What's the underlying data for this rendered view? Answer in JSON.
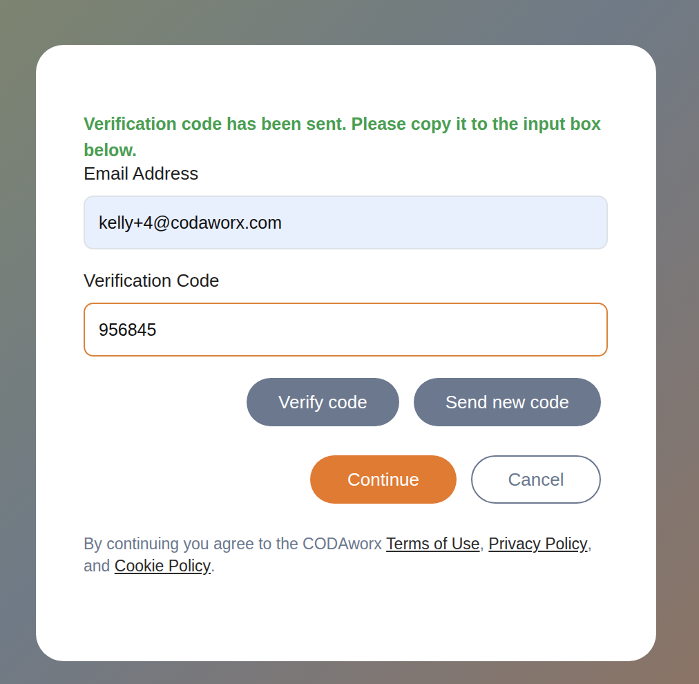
{
  "message": "Verification code has been sent. Please copy it to the input box below.",
  "fields": [
    {
      "label": "Email Address",
      "value": "kelly+4@codaworx.com",
      "kind": "filled",
      "focused": false
    },
    {
      "label": "Verification Code",
      "value": "956845",
      "kind": "plain",
      "focused": true
    }
  ],
  "code_buttons": [
    "Verify code",
    "Send new code"
  ],
  "actions": [
    {
      "label": "Continue",
      "kind": "primary"
    },
    {
      "label": "Cancel",
      "kind": "outline"
    }
  ],
  "footer": [
    {
      "text": "By continuing you agree to the CODAworx ",
      "link": false
    },
    {
      "text": "Terms of Use",
      "link": true
    },
    {
      "text": ", ",
      "link": false
    },
    {
      "text": "Privacy Policy",
      "link": true
    },
    {
      "text": ", and ",
      "link": false
    },
    {
      "text": "Cookie Policy",
      "link": true
    },
    {
      "text": ".",
      "link": false
    }
  ]
}
